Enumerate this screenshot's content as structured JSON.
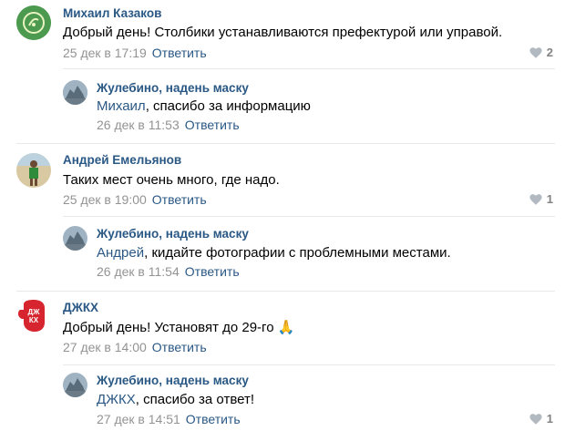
{
  "comments": [
    {
      "author": "Михаил Казаков",
      "text": "Добрый день! Столбики устанавливаются префектурой или управой.",
      "date": "25 дек в 17:19",
      "reply": "Ответить",
      "likes": "2",
      "replies": [
        {
          "author": "Жулебино, надень маску",
          "mention": "Михаил",
          "text": ", спасибо за информацию",
          "date": "26 дек в 11:53",
          "reply": "Ответить"
        }
      ]
    },
    {
      "author": "Андрей Емельянов",
      "text": "Таких мест очень много, где надо.",
      "date": "25 дек в 19:00",
      "reply": "Ответить",
      "likes": "1",
      "replies": [
        {
          "author": "Жулебино, надень маску",
          "mention": "Андрей",
          "text": ", кидайте фотографии с проблемными местами.",
          "date": "26 дек в 11:54",
          "reply": "Ответить"
        }
      ]
    },
    {
      "author": "ДЖКХ",
      "text": "Добрый день! Установят до 29-го",
      "emoji": "🙏",
      "date": "27 дек в 14:00",
      "reply": "Ответить",
      "avatar_text": "ДЖ КХ",
      "replies": [
        {
          "author": "Жулебино, надень маску",
          "mention": "ДЖКХ",
          "text": ", спасибо за ответ!",
          "date": "27 дек в 14:51",
          "reply": "Ответить",
          "likes": "1"
        }
      ]
    }
  ],
  "colors": {
    "link": "#2a5885",
    "meta": "#939393",
    "divider": "#e7e8ec"
  }
}
